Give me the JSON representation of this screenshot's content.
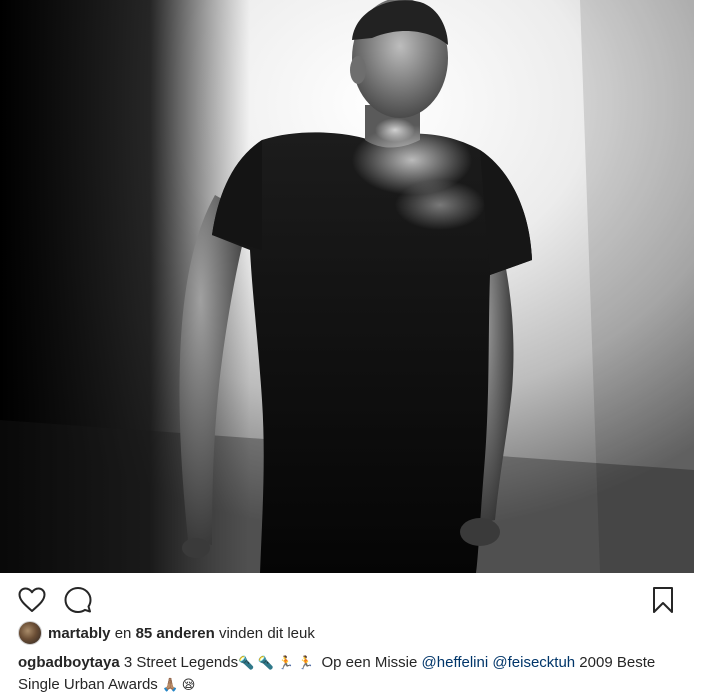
{
  "post": {
    "photo_alt": "",
    "likes": {
      "user": "martably",
      "connector": " en ",
      "count_text": "85 anderen",
      "suffix": " vinden dit leuk"
    },
    "caption": {
      "author": "ogbadboytaya",
      "text_1": " 3 Street Legends",
      "emoji_1": "🔦 🔦 🏃 🏃 ",
      "text_2": " Op een Missie ",
      "mention_1": "@heffelini",
      "text_3": " ",
      "mention_2": "@feisecktuh",
      "text_4": " 2009 Beste Single Urban Awards ",
      "emoji_2": "🙏🏽 😪"
    }
  },
  "icons": {
    "like": "heart-outline-icon",
    "comment": "speech-bubble-icon",
    "save": "bookmark-icon"
  },
  "colors": {
    "text": "#262626",
    "mention": "#003569"
  }
}
